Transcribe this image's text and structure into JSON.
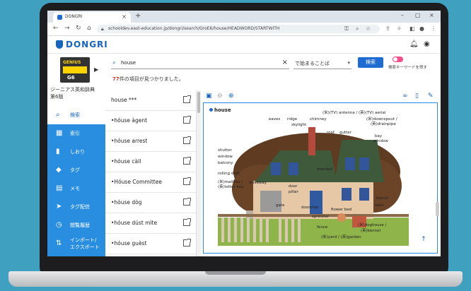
{
  "browser": {
    "tab_title": "DONGRI",
    "url": "schooldev.east-education.jp/dongri/search/GroE6/house/HEADWORD/STARTWITH"
  },
  "app": {
    "logo": "DONGRI"
  },
  "book": {
    "cover_series": "GENIUS",
    "cover_edition": "G6",
    "title_line1": "ジーニアス英和辞典",
    "title_line2": "第6版"
  },
  "sidebar": {
    "items": [
      {
        "label": "検索",
        "icon": "search-icon"
      },
      {
        "label": "索引",
        "icon": "grid-icon"
      },
      {
        "label": "しおり",
        "icon": "bookmark-icon"
      },
      {
        "label": "タグ",
        "icon": "tag-icon"
      },
      {
        "label": "メモ",
        "icon": "memo-icon"
      },
      {
        "label": "タグ配信",
        "icon": "share-tag-icon"
      },
      {
        "label": "閲覧履歴",
        "icon": "history-icon"
      },
      {
        "label": "インポート/\nエクスポート",
        "icon": "import-export-icon"
      }
    ]
  },
  "search": {
    "query": "house",
    "mode": "で始まることば",
    "button": "検索",
    "keyword_toggle_label": "検索キーワードを残す",
    "result_count": "77",
    "result_suffix": "件の項目が見つかりました。"
  },
  "results": [
    "house ***",
    "•hóuse àgent",
    "•hóuse arrest",
    "•hóuse càll",
    "•Hóuse Committee",
    "•hóuse dòg",
    "•hóuse dúst mìte",
    "•hóuse guèst"
  ],
  "detail": {
    "headword": "house",
    "labels": {
      "eaves": "eaves",
      "ridge": "ridge",
      "skylight": "skylight",
      "chimney": "chimney",
      "tv_antenna": "(米)(TV) antenna / (英)(TV) aerial",
      "downspout": "(米)downspout /",
      "drainpipe": "(英)drainpipe",
      "roof": "roof",
      "gutter": "gutter",
      "bay_window": "bay",
      "bay_window2": "window",
      "shutter": "shutter",
      "window": "window",
      "balcony": "balcony",
      "rolling_door": "rolling door",
      "mailbox": "(米)mailbox /",
      "letter_box": "(英)letter box",
      "driveway": "driveway",
      "doorbell": "doorbell",
      "door": "door",
      "pillar": "pillar",
      "bench": "bench",
      "lawn": "lawn",
      "gate": "gate",
      "doorstep": "doorstep",
      "flower_bed": "flower bed",
      "sprinkler": "sprinkler",
      "doghouse": "(米)doghouse /",
      "kennel": "(英)kennel",
      "fence": "fence",
      "yard_garden": "(米)yard / (英)garden"
    }
  },
  "colors": {
    "accent": "#1e6bd2",
    "sidebar": "#2a8ee0",
    "count": "#d9452c",
    "toggle": "#f2508c"
  }
}
